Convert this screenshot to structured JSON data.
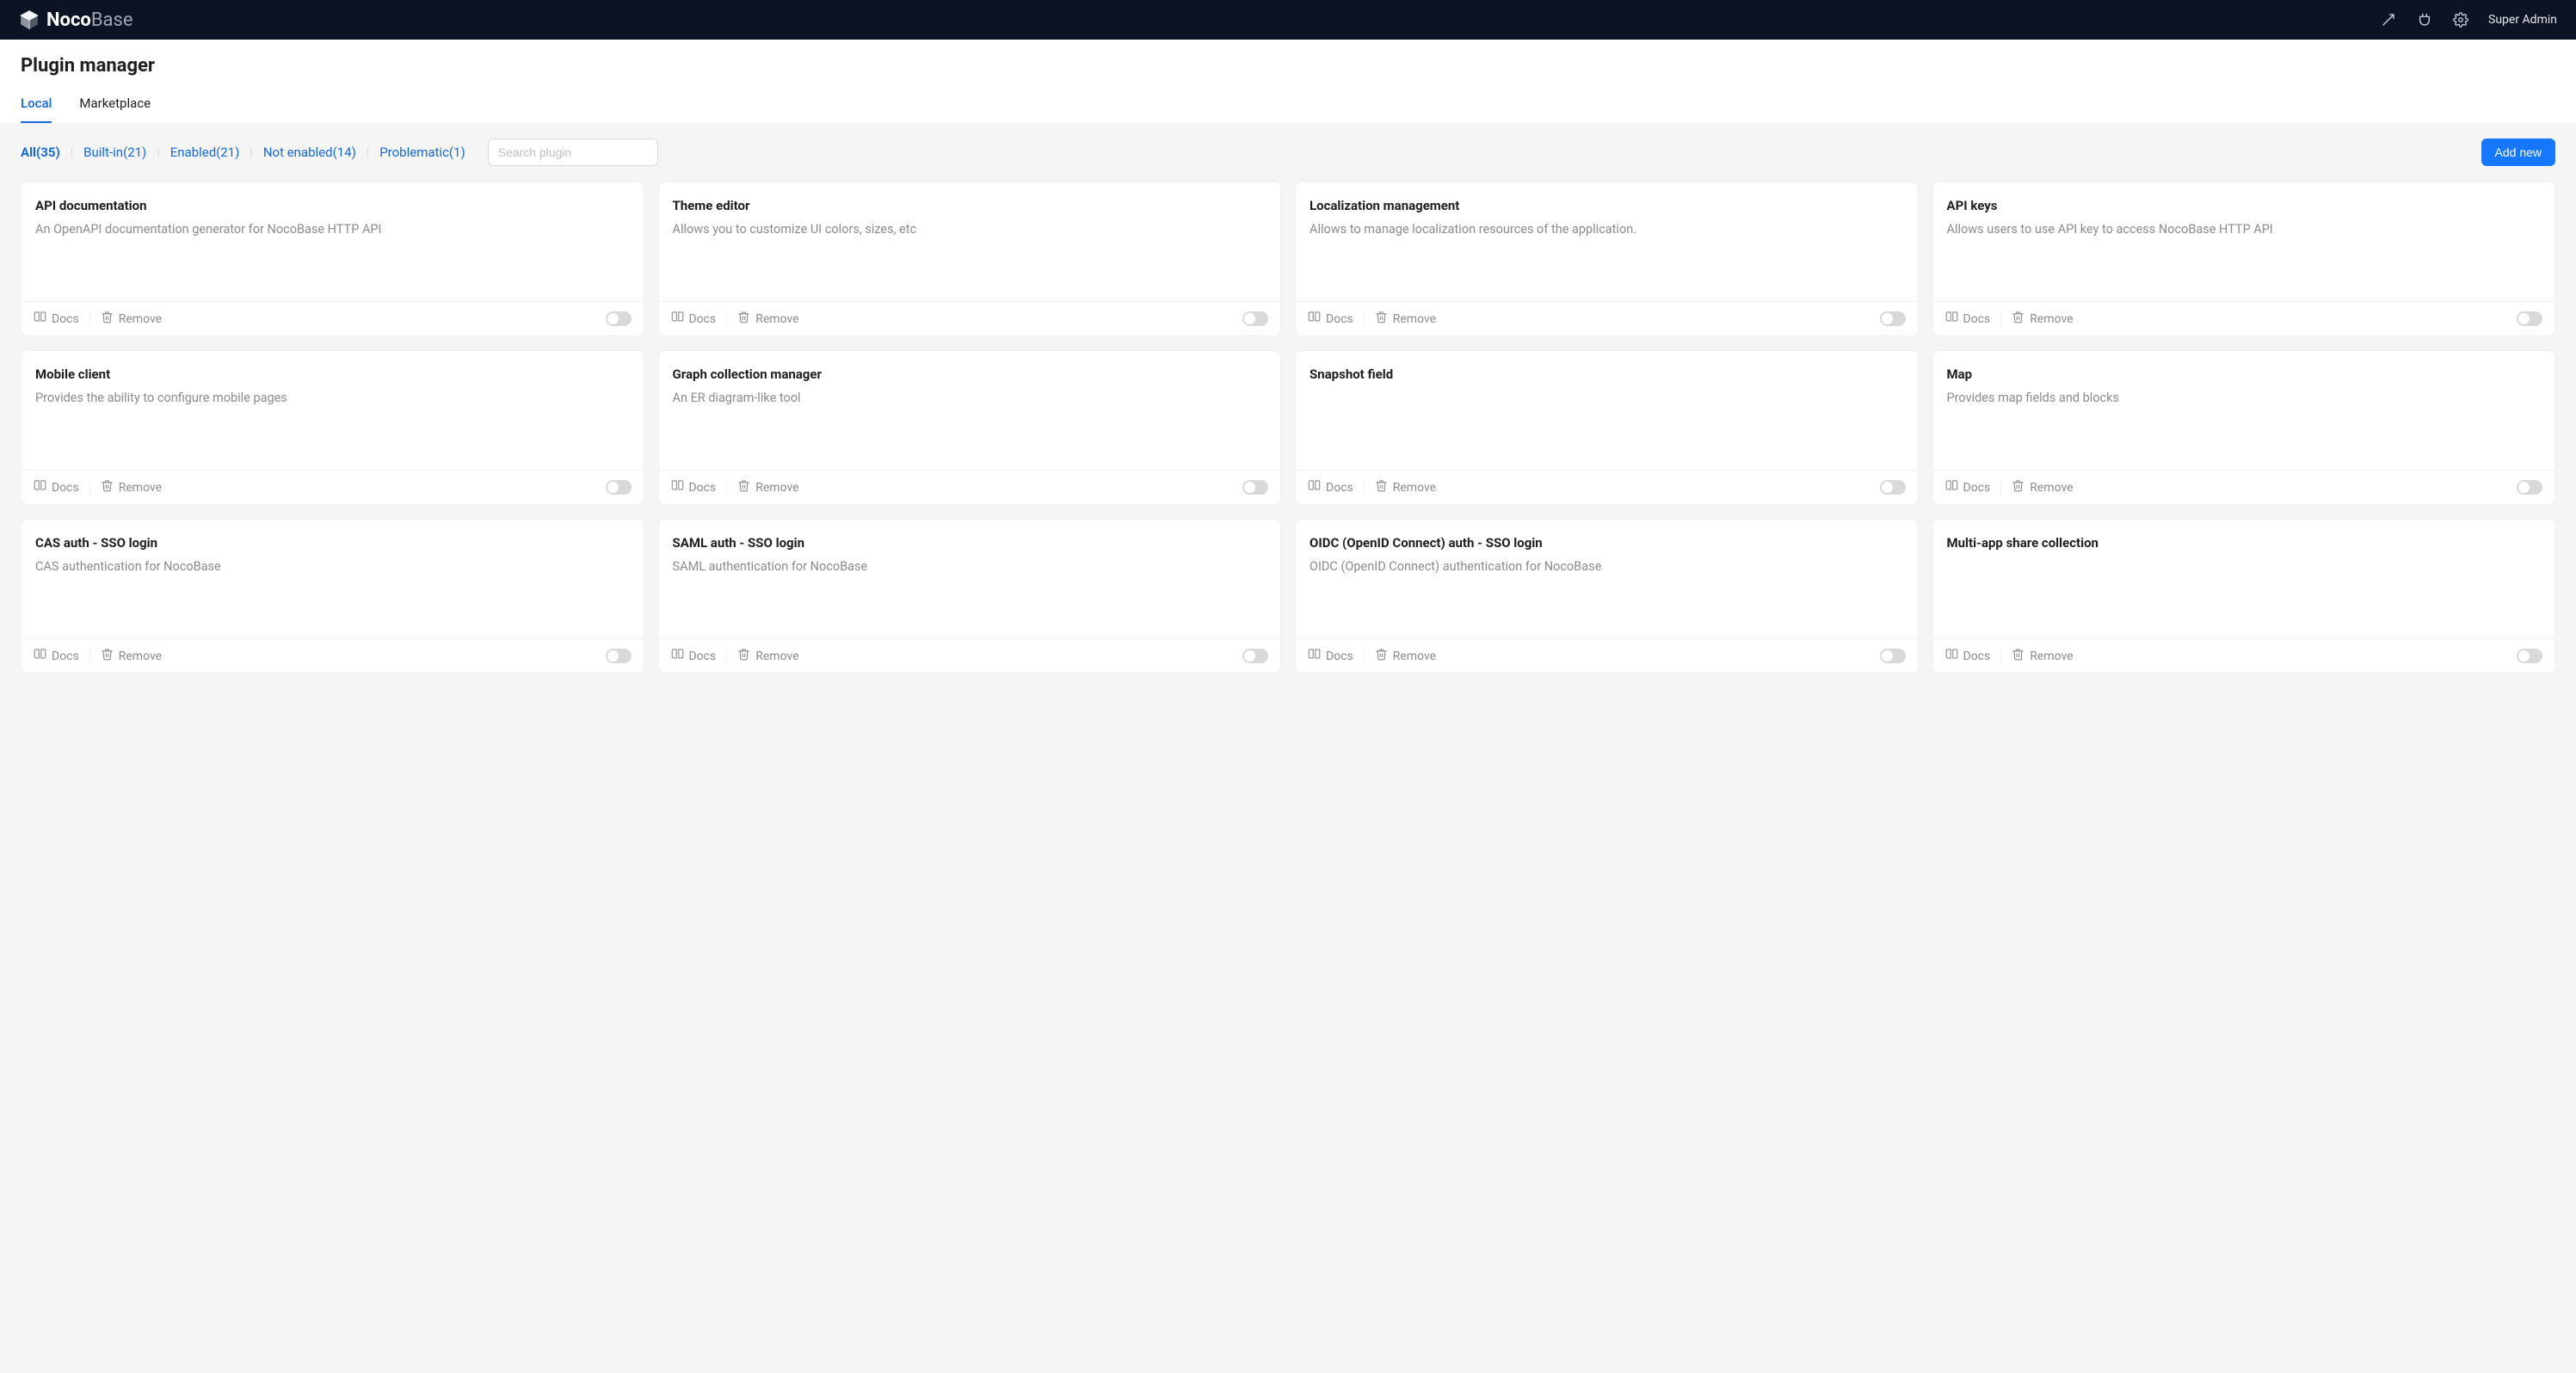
{
  "brand": {
    "strong": "Noco",
    "rest": "Base"
  },
  "user_name": "Super Admin",
  "page_title": "Plugin manager",
  "tabs": [
    {
      "label": "Local",
      "active": true
    },
    {
      "label": "Marketplace",
      "active": false
    }
  ],
  "filters": [
    {
      "label": "All(35)",
      "active": true
    },
    {
      "label": "Built-in(21)",
      "active": false
    },
    {
      "label": "Enabled(21)",
      "active": false
    },
    {
      "label": "Not enabled(14)",
      "active": false
    },
    {
      "label": "Problematic(1)",
      "active": false
    }
  ],
  "search_placeholder": "Search plugin",
  "add_new_label": "Add new",
  "card_actions": {
    "docs": "Docs",
    "remove": "Remove"
  },
  "plugins": [
    {
      "title": "API documentation",
      "desc": "An OpenAPI documentation generator for NocoBase HTTP API",
      "enabled": false
    },
    {
      "title": "Theme editor",
      "desc": "Allows you to customize UI colors, sizes, etc",
      "enabled": false
    },
    {
      "title": "Localization management",
      "desc": "Allows to manage localization resources of the application.",
      "enabled": false
    },
    {
      "title": "API keys",
      "desc": "Allows users to use API key to access NocoBase HTTP API",
      "enabled": false
    },
    {
      "title": "Mobile client",
      "desc": "Provides the ability to configure mobile pages",
      "enabled": false
    },
    {
      "title": "Graph collection manager",
      "desc": "An ER diagram-like tool",
      "enabled": false
    },
    {
      "title": "Snapshot field",
      "desc": "",
      "enabled": false
    },
    {
      "title": "Map",
      "desc": "Provides map fields and blocks",
      "enabled": false
    },
    {
      "title": "CAS auth - SSO login",
      "desc": "CAS authentication for NocoBase",
      "enabled": false
    },
    {
      "title": "SAML auth - SSO login",
      "desc": "SAML authentication for NocoBase",
      "enabled": false
    },
    {
      "title": "OIDC (OpenID Connect) auth - SSO login",
      "desc": "OIDC (OpenID Connect) authentication for NocoBase",
      "enabled": false
    },
    {
      "title": "Multi-app share collection",
      "desc": "",
      "enabled": false
    }
  ]
}
